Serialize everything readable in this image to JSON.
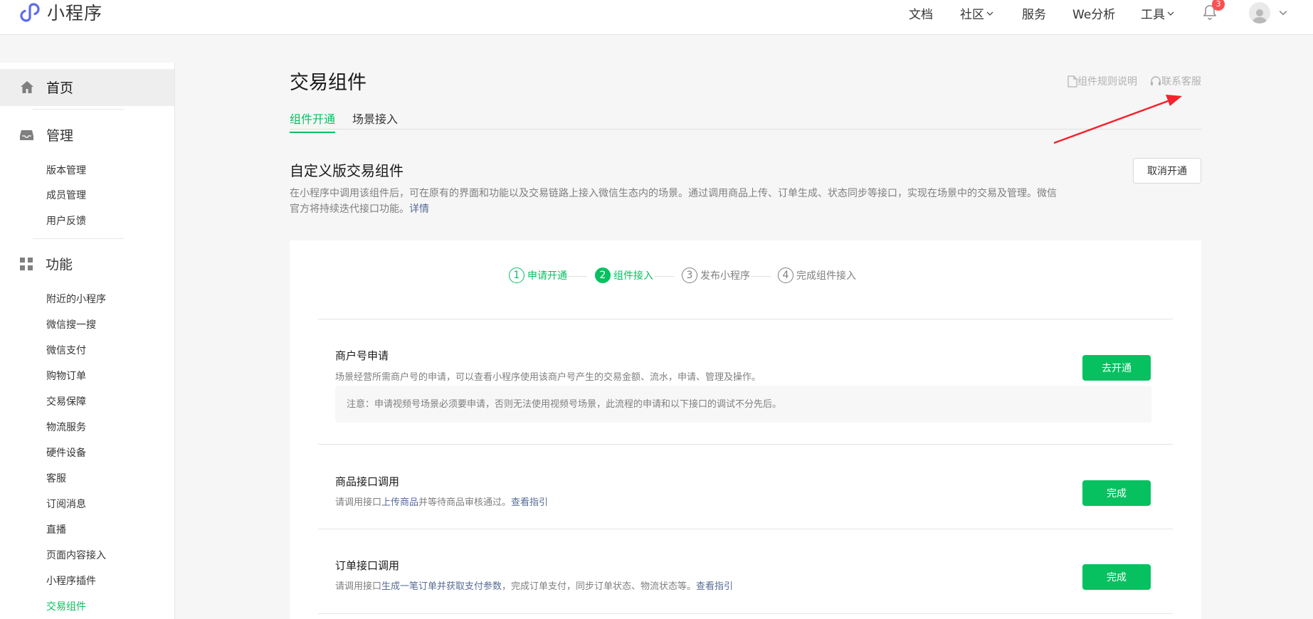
{
  "header": {
    "app_name": "小程序",
    "nav": [
      {
        "label": "文档"
      },
      {
        "label": "社区"
      },
      {
        "label": "服务"
      },
      {
        "label": "We分析"
      },
      {
        "label": "工具"
      }
    ],
    "notification_count": "3",
    "icons": {
      "logo": "miniprogram-logo-icon",
      "bell": "bell-icon",
      "avatar": "user-avatar-icon",
      "caret": "chevron-down-icon"
    }
  },
  "sidebar": {
    "home": "首页",
    "manage": {
      "label": "管理",
      "items": [
        "版本管理",
        "成员管理",
        "用户反馈"
      ]
    },
    "features": {
      "label": "功能",
      "items": [
        "附近的小程序",
        "微信搜一搜",
        "微信支付",
        "购物订单",
        "交易保障",
        "物流服务",
        "硬件设备",
        "客服",
        "订阅消息",
        "直播",
        "页面内容接入",
        "小程序插件",
        "交易组件"
      ],
      "active": "交易组件"
    }
  },
  "main": {
    "title": "交易组件",
    "links": {
      "rules": "组件规则说明",
      "contact": "联系客服"
    },
    "tabs": [
      "组件开通",
      "场景接入"
    ],
    "active_tab": "组件开通",
    "section": {
      "title": "自定义版交易组件",
      "desc": "在小程序中调用该组件后，可在原有的界面和功能以及交易链路上接入微信生态内的场景。通过调用商品上传、订单生成、状态同步等接口，实现在场景中的交易及管理。微信官方将持续迭代接口功能。",
      "desc_link": "详情",
      "cancel_button": "取消开通"
    },
    "steps": [
      {
        "num": "1",
        "label": "申请开通",
        "state": "done"
      },
      {
        "num": "2",
        "label": "组件接入",
        "state": "current"
      },
      {
        "num": "3",
        "label": "发布小程序",
        "state": "todo"
      },
      {
        "num": "4",
        "label": "完成组件接入",
        "state": "todo"
      }
    ],
    "items": [
      {
        "title": "商户号申请",
        "desc": "场景经营所需商户号的申请，可以查看小程序使用该商户号产生的交易金额、流水，申请、管理及操作。",
        "note": "注意：申请视频号场景必须要申请，否则无法使用视频号场景，此流程的申请和以下接口的调试不分先后。",
        "button": "去开通"
      },
      {
        "title": "商品接口调用",
        "desc_prefix": "请调用接口",
        "desc_link1": "上传商品",
        "desc_mid": "并等待商品审核通过。",
        "desc_link2": "查看指引",
        "button": "完成"
      },
      {
        "title": "订单接口调用",
        "desc_prefix": "请调用接口",
        "desc_link1": "生成一笔订单并获取支付参数",
        "desc_mid": "，完成订单支付，同步订单状态、物流状态等。",
        "desc_link2": "查看指引",
        "button": "完成"
      }
    ]
  },
  "colors": {
    "accent": "#07c160",
    "link": "#576b95",
    "badge": "#fa5151",
    "annotation_arrow": "#f5222d"
  }
}
